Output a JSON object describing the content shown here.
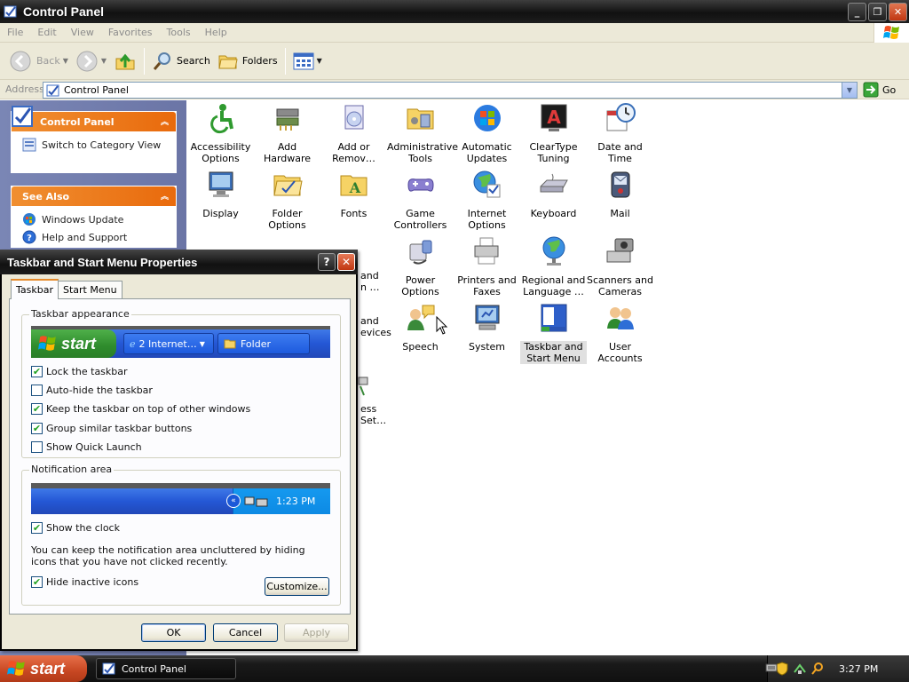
{
  "window": {
    "title": "Control Panel",
    "minimize": "_",
    "restore": "❐",
    "close": "✕"
  },
  "menu": [
    "File",
    "Edit",
    "View",
    "Favorites",
    "Tools",
    "Help"
  ],
  "toolbar": {
    "back": "Back",
    "search": "Search",
    "folders": "Folders"
  },
  "address": {
    "label": "Address",
    "value": "Control Panel",
    "go": "Go"
  },
  "leftpane": {
    "control_panel": {
      "title": "Control Panel",
      "link": "Switch to Category View"
    },
    "see_also": {
      "title": "See Also",
      "links": [
        "Windows Update",
        "Help and Support"
      ]
    }
  },
  "items": [
    {
      "label": "Accessibility Options",
      "icon": "accessibility-icon"
    },
    {
      "label": "Add Hardware",
      "icon": "add-hardware-icon"
    },
    {
      "label": "Add or Remov…",
      "icon": "add-remove-programs-icon"
    },
    {
      "label": "Administrative Tools",
      "icon": "administrative-tools-icon"
    },
    {
      "label": "Automatic Updates",
      "icon": "automatic-updates-icon"
    },
    {
      "label": "ClearType Tuning",
      "icon": "cleartype-icon"
    },
    {
      "label": "Date and Time",
      "icon": "date-time-icon"
    },
    {
      "label": "Display",
      "icon": "display-icon"
    },
    {
      "label": "Folder Options",
      "icon": "folder-options-icon"
    },
    {
      "label": "Fonts",
      "icon": "fonts-icon"
    },
    {
      "label": "Game Controllers",
      "icon": "game-controllers-icon"
    },
    {
      "label": "Internet Options",
      "icon": "internet-options-icon"
    },
    {
      "label": "Keyboard",
      "icon": "keyboard-icon"
    },
    {
      "label": "Mail",
      "icon": "mail-icon"
    },
    {
      "label": "Power Options",
      "icon": "power-options-icon"
    },
    {
      "label": "Printers and Faxes",
      "icon": "printers-faxes-icon"
    },
    {
      "label": "Regional and Language …",
      "icon": "regional-language-icon"
    },
    {
      "label": "Scanners and Cameras",
      "icon": "scanners-cameras-icon"
    },
    {
      "label": "Speech",
      "icon": "speech-icon"
    },
    {
      "label": "System",
      "icon": "system-icon"
    },
    {
      "label": "Taskbar and Start Menu",
      "icon": "taskbar-start-menu-icon"
    },
    {
      "label": "User Accounts",
      "icon": "user-accounts-icon"
    }
  ],
  "partial_items": {
    "a": "and",
    "b": "n …",
    "c": "and",
    "d": "evices",
    "e": "ess",
    "f": "Set…"
  },
  "dialog": {
    "title": "Taskbar and Start Menu Properties",
    "help": "?",
    "close": "✕",
    "tabs": [
      "Taskbar",
      "Start Menu"
    ],
    "appearance": {
      "caption": "Taskbar appearance",
      "preview_start": "start",
      "preview_task1": "2 Internet…",
      "preview_task2": "Folder",
      "options": [
        {
          "label": "Lock the taskbar",
          "checked": true
        },
        {
          "label": "Auto-hide the taskbar",
          "checked": false
        },
        {
          "label": "Keep the taskbar on top of other windows",
          "checked": true
        },
        {
          "label": "Group similar taskbar buttons",
          "checked": true
        },
        {
          "label": "Show Quick Launch",
          "checked": false
        }
      ]
    },
    "notification": {
      "caption": "Notification area",
      "preview_time": "1:23 PM",
      "show_clock": {
        "label": "Show the clock",
        "checked": true
      },
      "description": "You can keep the notification area uncluttered by hiding icons that you have not clicked recently.",
      "hide_inactive": {
        "label": "Hide inactive icons",
        "checked": true
      },
      "customize": "Customize..."
    },
    "buttons": {
      "ok": "OK",
      "cancel": "Cancel",
      "apply": "Apply"
    }
  },
  "taskbar": {
    "start": "start",
    "task": "Control Panel",
    "time": "3:27 PM"
  },
  "colors": {
    "title_bar": "#1a1a1a",
    "panel_header": "#ed7a1d",
    "left_pane": "#7380b0",
    "start_button": "#c74722"
  }
}
